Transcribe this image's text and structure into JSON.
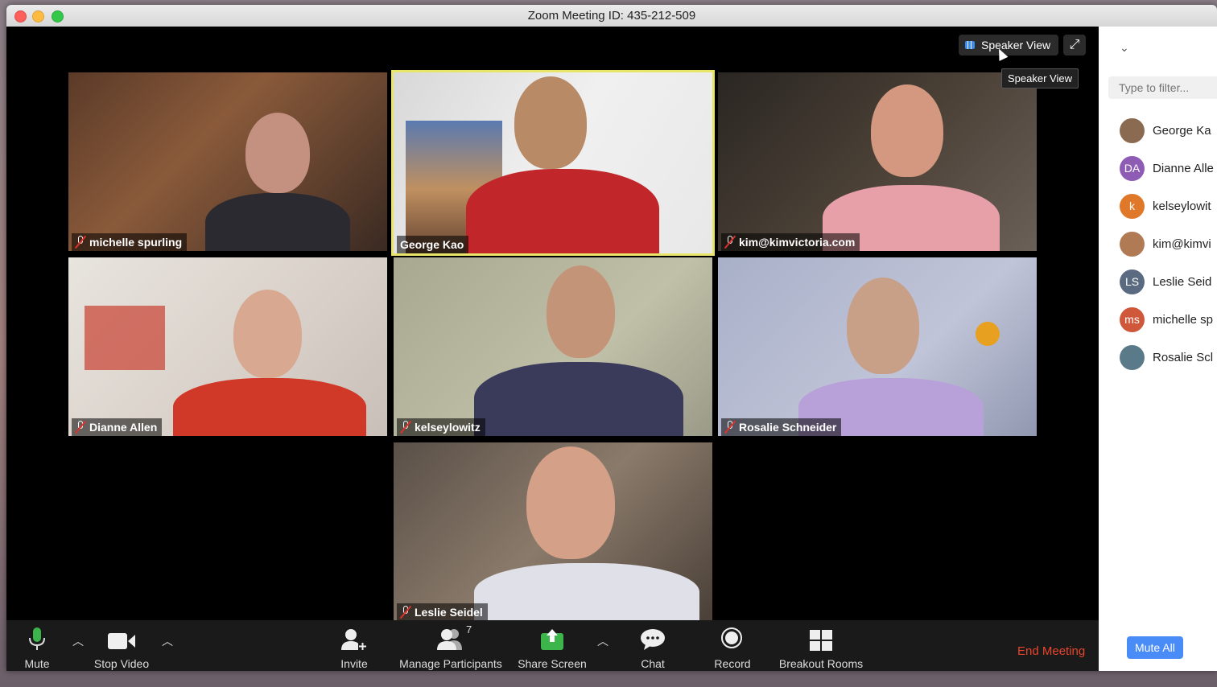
{
  "window": {
    "title": "Zoom Meeting ID: 435-212-509"
  },
  "view_controls": {
    "speaker_view_label": "Speaker View",
    "tooltip": "Speaker View"
  },
  "tiles": [
    {
      "name": "michelle spurling",
      "muted": true,
      "active": false
    },
    {
      "name": "George Kao",
      "muted": false,
      "active": true
    },
    {
      "name": "kim@kimvictoria.com",
      "muted": true,
      "active": false
    },
    {
      "name": "Dianne Allen",
      "muted": true,
      "active": false
    },
    {
      "name": "kelseylowitz",
      "muted": true,
      "active": false
    },
    {
      "name": "Rosalie Schneider",
      "muted": true,
      "active": false
    },
    {
      "name": "Leslie Seidel",
      "muted": true,
      "active": false
    }
  ],
  "toolbar": {
    "mute": "Mute",
    "stop_video": "Stop Video",
    "invite": "Invite",
    "manage_participants": "Manage Participants",
    "participant_count": "7",
    "share_screen": "Share Screen",
    "chat": "Chat",
    "record": "Record",
    "breakout_rooms": "Breakout Rooms",
    "end_meeting": "End Meeting"
  },
  "participants_panel": {
    "filter_placeholder": "Type to filter...",
    "participants": [
      {
        "initials": "",
        "name": "George Ka",
        "color": "#8a6a50"
      },
      {
        "initials": "DA",
        "name": "Dianne Alle",
        "color": "#8e5bb5"
      },
      {
        "initials": "k",
        "name": "kelseylowit",
        "color": "#e0782a"
      },
      {
        "initials": "",
        "name": "kim@kimvi",
        "color": "#b07a55"
      },
      {
        "initials": "LS",
        "name": "Leslie Seid",
        "color": "#5a6a80"
      },
      {
        "initials": "ms",
        "name": "michelle sp",
        "color": "#d0583a"
      },
      {
        "initials": "",
        "name": "Rosalie Scl",
        "color": "#5a7a8a"
      }
    ],
    "mute_all": "Mute All"
  },
  "colors": {
    "accent": "#4a8cf7",
    "end_meeting": "#e8452c",
    "active_speaker_border": "#e9e46a",
    "muted_slash": "#e0312b"
  }
}
